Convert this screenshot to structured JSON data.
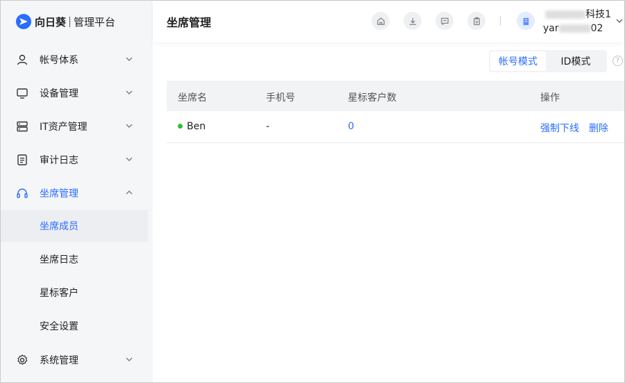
{
  "brand": {
    "name": "向日葵",
    "subtitle": "管理平台"
  },
  "colors": {
    "accent": "#2a6cff",
    "online": "#2fbd3a",
    "sidebar_bg": "#f5f6f8"
  },
  "sidebar": {
    "items": [
      {
        "label": "帐号体系",
        "icon": "user-icon"
      },
      {
        "label": "设备管理",
        "icon": "monitor-icon"
      },
      {
        "label": "IT资产管理",
        "icon": "server-icon"
      },
      {
        "label": "审计日志",
        "icon": "document-icon"
      },
      {
        "label": "坐席管理",
        "icon": "headset-icon",
        "expanded": true,
        "children": [
          {
            "label": "坐席成员",
            "selected": true
          },
          {
            "label": "坐席日志"
          },
          {
            "label": "星标客户"
          },
          {
            "label": "安全设置"
          }
        ]
      },
      {
        "label": "系统管理",
        "icon": "gear-icon"
      }
    ]
  },
  "header": {
    "title": "坐席管理",
    "user_org_suffix": "科技1",
    "user_id_prefix": "yar",
    "user_id_suffix": "02"
  },
  "mode_switch": {
    "options": [
      "帐号模式",
      "ID模式"
    ],
    "selected": "帐号模式",
    "help": "?"
  },
  "table": {
    "columns": [
      "坐席名",
      "手机号",
      "星标客户数",
      "操作"
    ],
    "rows": [
      {
        "name": "Ben",
        "status": "online",
        "phone": "-",
        "starred_count": "0",
        "actions": [
          "强制下线",
          "删除"
        ]
      }
    ]
  }
}
